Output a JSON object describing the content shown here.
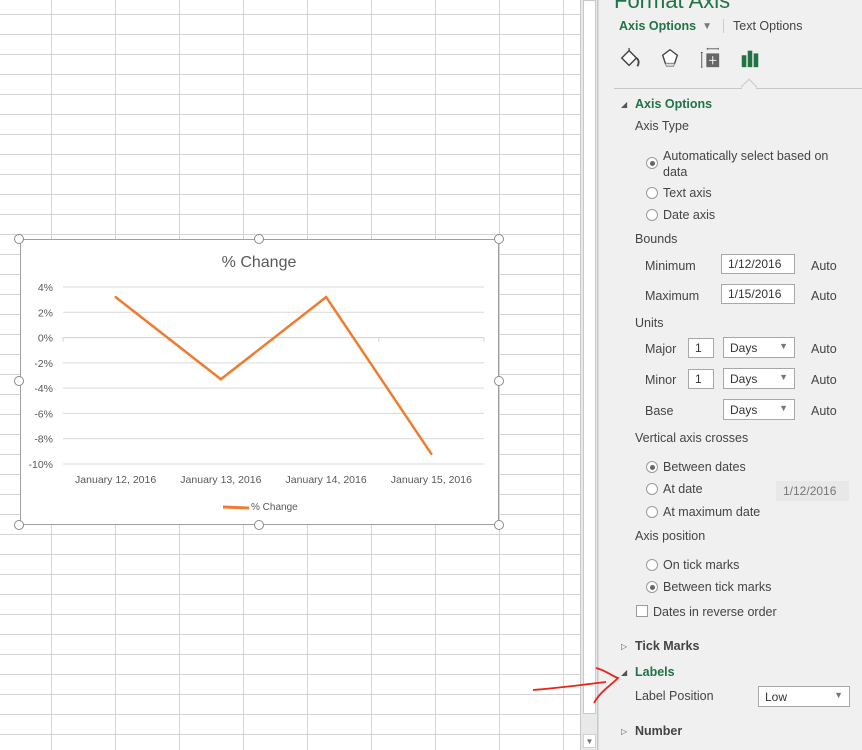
{
  "chart_data": {
    "type": "line",
    "title": "% Change",
    "categories": [
      "January 12, 2016",
      "January 13, 2016",
      "January 14, 2016",
      "January 15, 2016"
    ],
    "series": [
      {
        "name": "% Change",
        "color": "#ED7D31",
        "values": [
          3.2,
          -3.3,
          3.2,
          -9.2
        ]
      }
    ],
    "yticks": [
      "4%",
      "2%",
      "0%",
      "-2%",
      "-4%",
      "-6%",
      "-8%",
      "-10%"
    ],
    "ylim": [
      -10,
      4
    ],
    "ystep": 2,
    "xlabel": "",
    "ylabel": "",
    "grid": true,
    "legend": "bottom"
  },
  "pane": {
    "title": "Format Axis",
    "tabs": {
      "axis_options": "Axis Options",
      "text_options": "Text Options"
    },
    "icons": [
      "fill-line-icon",
      "effects-icon",
      "size-properties-icon",
      "axis-options-icon"
    ],
    "sections": {
      "axis_options": "Axis Options",
      "tick_marks": "Tick Marks",
      "labels": "Labels",
      "number": "Number"
    },
    "axis_type": {
      "label": "Axis Type",
      "options": [
        {
          "label_line1": "Automatically select based on",
          "label_line2": "data",
          "selected": true
        },
        {
          "label": "Text axis",
          "selected": false
        },
        {
          "label": "Date axis",
          "selected": false
        }
      ]
    },
    "bounds": {
      "label": "Bounds",
      "minimum": {
        "label": "Minimum",
        "value": "1/12/2016",
        "auto": "Auto"
      },
      "maximum": {
        "label": "Maximum",
        "value": "1/15/2016",
        "auto": "Auto"
      }
    },
    "units": {
      "label": "Units",
      "major": {
        "label": "Major",
        "value": "1",
        "unit": "Days",
        "auto": "Auto"
      },
      "minor": {
        "label": "Minor",
        "value": "1",
        "unit": "Days",
        "auto": "Auto"
      },
      "base": {
        "label": "Base",
        "unit": "Days",
        "auto": "Auto"
      }
    },
    "vertical_axis_crosses": {
      "label": "Vertical axis crosses",
      "options": [
        {
          "label": "Between dates",
          "selected": true
        },
        {
          "label": "At date",
          "selected": false,
          "value": "1/12/2016"
        },
        {
          "label": "At maximum date",
          "selected": false
        }
      ]
    },
    "axis_position": {
      "label": "Axis position",
      "options": [
        {
          "label": "On tick marks",
          "selected": false
        },
        {
          "label": "Between tick marks",
          "selected": true
        }
      ],
      "reverse_label": "Dates in reverse order",
      "reverse_checked": false
    },
    "labels": {
      "position_label": "Label Position",
      "position_value": "Low"
    }
  }
}
